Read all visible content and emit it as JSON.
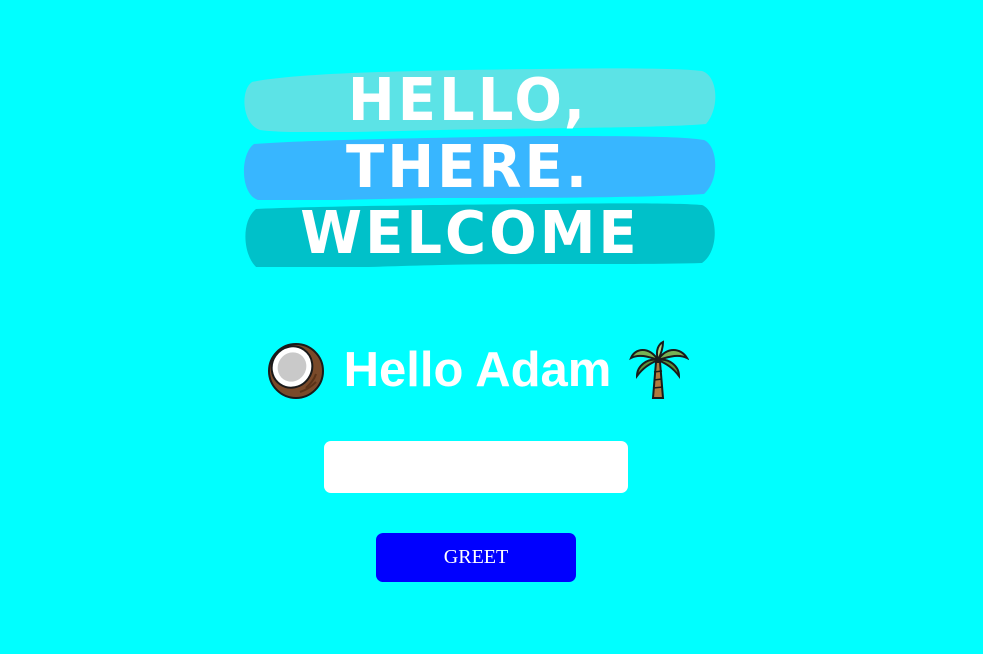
{
  "hero": {
    "line1": "HELLO,",
    "line2": "THERE.",
    "line3": "WELCOME",
    "stroke_colors": [
      "#5ce3e6",
      "#38b6ff",
      "#00c1c9"
    ]
  },
  "greeting": {
    "text": "Hello Adam",
    "left_icon": "coconut-icon",
    "right_icon": "palm-tree-icon"
  },
  "form": {
    "name_value": "",
    "name_placeholder": "",
    "greet_label": "GREET"
  },
  "colors": {
    "background": "#00ffff",
    "button": "#0000ff",
    "text": "#ffffff"
  }
}
